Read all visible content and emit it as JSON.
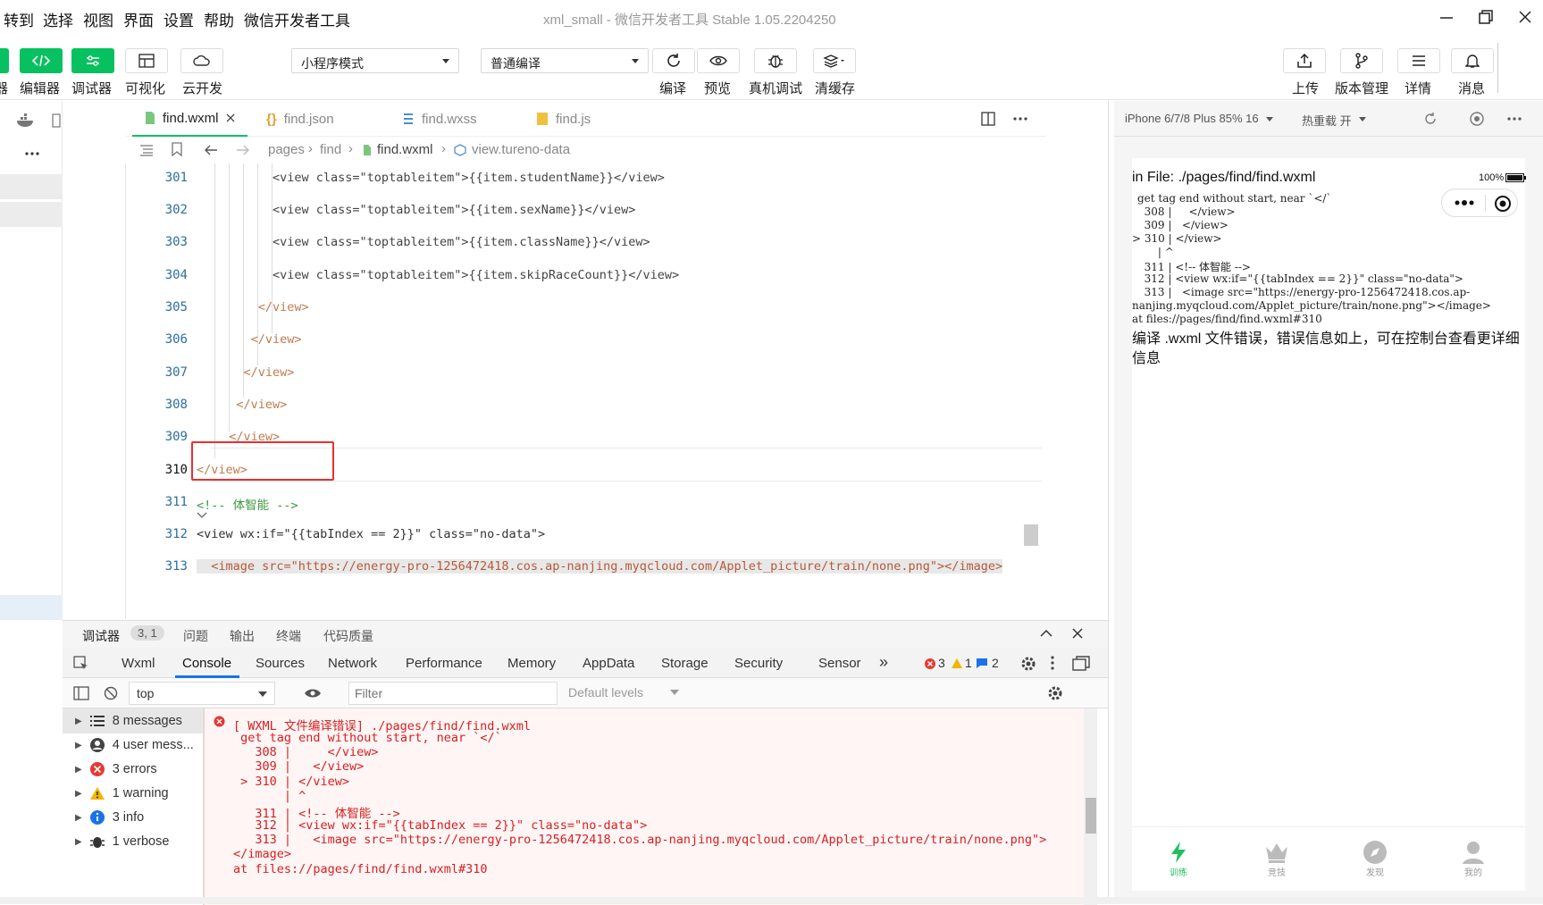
{
  "menu": [
    "转到",
    "选择",
    "视图",
    "界面",
    "设置",
    "帮助",
    "微信开发者工具"
  ],
  "window_title": "xml_small - 微信开发者工具 Stable 1.05.2204250",
  "toolbar": {
    "left_buttons": [
      "编辑器",
      "调试器",
      "可视化",
      "云开发"
    ],
    "left_prefix": "器",
    "mode_select": "小程序模式",
    "compile_select": "普通编译",
    "mid_buttons": [
      "编译",
      "预览",
      "真机调试",
      "清缓存"
    ],
    "right_buttons": [
      "上传",
      "版本管理",
      "详情",
      "消息"
    ]
  },
  "tabs": [
    "find.wxml",
    "find.json",
    "find.wxss",
    "find.js"
  ],
  "breadcrumb": [
    "pages",
    "find",
    "find.wxml",
    "view.tureno-data"
  ],
  "editor_lines": [
    {
      "n": "301",
      "text": "        <view class=\"toptableitem\">{{item.studentName}}</view>"
    },
    {
      "n": "302",
      "text": "        <view class=\"toptableitem\">{{item.sexName}}</view>"
    },
    {
      "n": "303",
      "text": "        <view class=\"toptableitem\">{{item.className}}</view>"
    },
    {
      "n": "304",
      "text": "        <view class=\"toptableitem\">{{item.skipRaceCount}}</view>"
    },
    {
      "n": "305",
      "text": "      </view>"
    },
    {
      "n": "306",
      "text": "     </view>"
    },
    {
      "n": "307",
      "text": "    </view>"
    },
    {
      "n": "308",
      "text": "   </view>"
    },
    {
      "n": "309",
      "text": "  </view>"
    },
    {
      "n": "310",
      "text": "</view>"
    },
    {
      "n": "311",
      "text": "<!-- 体智能 -->"
    },
    {
      "n": "312",
      "text": "<view wx:if=\"{{tabIndex == 2}}\" class=\"no-data\">"
    },
    {
      "n": "313",
      "text": "  <image src=\"https://energy-pro-1256472418.cos.ap-nanjing.myqcloud.com/Applet_picture/train/none.png\"></image>"
    }
  ],
  "devtools": {
    "subtabs": [
      "调试器",
      "3, 1",
      "问题",
      "输出",
      "终端",
      "代码质量"
    ],
    "tabs": [
      "Wxml",
      "Console",
      "Sources",
      "Network",
      "Performance",
      "Memory",
      "AppData",
      "Storage",
      "Security",
      "Sensor"
    ],
    "more": "»",
    "counts": {
      "errors": "3",
      "warnings": "1",
      "info": "2"
    },
    "context": "top",
    "filter_placeholder": "Filter",
    "levels": "Default levels",
    "sidebar": [
      {
        "label": "8 messages",
        "icon": "list-icon"
      },
      {
        "label": "4 user mess...",
        "icon": "user-icon"
      },
      {
        "label": "3 errors",
        "icon": "error-icon"
      },
      {
        "label": "1 warning",
        "icon": "warning-icon"
      },
      {
        "label": "3 info",
        "icon": "info-icon"
      },
      {
        "label": "1 verbose",
        "icon": "bug-icon"
      }
    ],
    "console_lines": [
      "[ WXML 文件编译错误] ./pages/find/find.wxml",
      " get tag end without start, near `</`",
      "   308 |     </view>",
      "   309 |   </view>",
      " > 310 | </view>",
      "       | ^",
      "   311 | <!-- 体智能 -->",
      "   312 | <view wx:if=\"{{tabIndex == 2}}\" class=\"no-data\">",
      "   313 |   <image src=\"https://energy-pro-1256472418.cos.ap-nanjing.myqcloud.com/Applet_picture/train/none.png\">",
      "</image>",
      "at files://pages/find/find.wxml#310"
    ]
  },
  "simulator": {
    "device": "iPhone 6/7/8 Plus 85% 16",
    "hot_reload": "热重载 开",
    "battery": "100%",
    "error_head": "in File: ./pages/find/find.wxml",
    "error_lines": [
      "get tag end without start, near `</`",
      "  308 |     </view>",
      "  309 |   </view>",
      "> 310 | </view>",
      "      | ^",
      "  311 | <!-- 体智能 -->",
      "  312 | <view wx:if=\"{{tabIndex == 2}}\" class=\"no-data\">",
      "  313 |   <image src=\"https://energy-pro-1256472418.cos.ap-",
      "nanjing.myqcloud.com/Applet_picture/train/none.png\"></image>",
      "at files://pages/find/find.wxml#310"
    ],
    "message": "编译 .wxml 文件错误，错误信息如上，可在控制台查看更详细信息",
    "nav": [
      "训练",
      "竞技",
      "发现",
      "我的"
    ]
  }
}
